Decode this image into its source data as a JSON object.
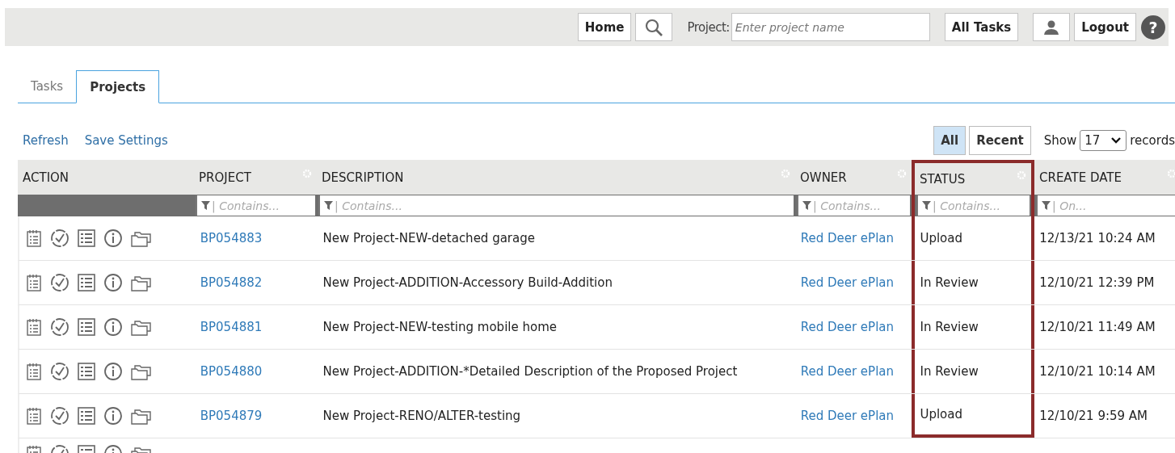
{
  "topbar": {
    "home": "Home",
    "project_label": "Project:",
    "project_placeholder": "Enter project name",
    "all_tasks": "All Tasks",
    "logout": "Logout",
    "help": "?"
  },
  "tabs": [
    {
      "label": "Tasks",
      "selected": false
    },
    {
      "label": "Projects",
      "selected": true
    }
  ],
  "actions": [
    "Refresh",
    "Save Settings"
  ],
  "view_toggle": [
    {
      "label": "All",
      "selected": true
    },
    {
      "label": "Recent",
      "selected": false
    }
  ],
  "paging": {
    "show": "Show",
    "value": "17",
    "records": "records"
  },
  "table": {
    "columns": [
      {
        "label": "ACTION",
        "highlighted": false
      },
      {
        "label": "PROJECT",
        "filter": "| Contains...",
        "highlighted": false
      },
      {
        "label": "DESCRIPTION",
        "filter": "| Contains...",
        "highlighted": false
      },
      {
        "label": "OWNER",
        "filter": "| Contains...",
        "highlighted": false
      },
      {
        "label": "STATUS",
        "filter": "| Contains...",
        "highlighted": true
      },
      {
        "label": "CREATE DATE",
        "filter": "| On...",
        "highlighted": false
      }
    ],
    "rows": [
      {
        "kind": "full",
        "project": "BP054883",
        "description": "New Project-NEW-detached garage",
        "owner": "Red Deer ePlan",
        "status": "Upload",
        "date": "12/13/21 10:24 AM"
      },
      {
        "kind": "full",
        "project": "BP054882",
        "description": "New Project-ADDITION-Accessory Build-Addition",
        "owner": "Red Deer ePlan",
        "status": "In Review",
        "date": "12/10/21 12:39 PM"
      },
      {
        "kind": "full",
        "project": "BP054881",
        "description": "New Project-NEW-testing mobile home",
        "owner": "Red Deer ePlan",
        "status": "In Review",
        "date": "12/10/21 11:49 AM"
      },
      {
        "kind": "full",
        "project": "BP054880",
        "description": "New Project-ADDITION-*Detailed Description of the Proposed Project",
        "owner": "Red Deer ePlan",
        "status": "In Review",
        "date": "12/10/21 10:14 AM"
      },
      {
        "kind": "full",
        "project": "BP054879",
        "description": "New Project-RENO/ALTER-testing",
        "owner": "Red Deer ePlan",
        "status": "Upload",
        "date": "12/10/21 9:59 AM"
      },
      {
        "kind": "cut"
      }
    ]
  }
}
